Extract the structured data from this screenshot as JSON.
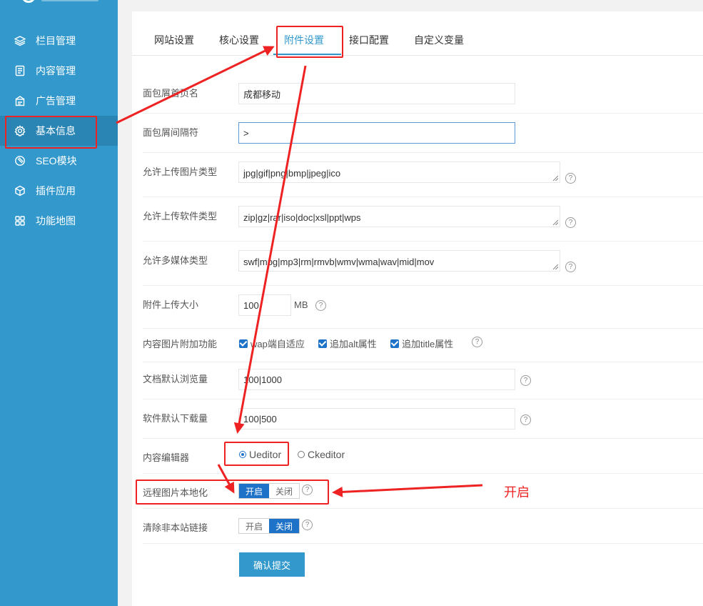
{
  "sidebar": {
    "items": [
      {
        "label": "栏目管理",
        "icon": "layers-icon"
      },
      {
        "label": "内容管理",
        "icon": "document-icon"
      },
      {
        "label": "广告管理",
        "icon": "ad-icon"
      },
      {
        "label": "基本信息",
        "icon": "gear-icon"
      },
      {
        "label": "SEO模块",
        "icon": "seo-icon"
      },
      {
        "label": "插件应用",
        "icon": "cube-icon"
      },
      {
        "label": "功能地图",
        "icon": "grid-icon"
      }
    ],
    "active_index": 3
  },
  "tabs": [
    "网站设置",
    "核心设置",
    "附件设置",
    "接口配置",
    "自定义变量"
  ],
  "active_tab": 2,
  "form": {
    "breadcrumb_home": {
      "label": "面包屑首页名",
      "value": "成都移动"
    },
    "breadcrumb_sep": {
      "label": "面包屑间隔符",
      "value": ">"
    },
    "img_types": {
      "label": "允许上传图片类型",
      "value": "jpg|gif|png|bmp|jpeg|ico"
    },
    "soft_types": {
      "label": "允许上传软件类型",
      "value": "zip|gz|rar|iso|doc|xsl|ppt|wps"
    },
    "media_types": {
      "label": "允许多媒体类型",
      "value": "swf|mpg|mp3|rm|rmvb|wmv|wma|wav|mid|mov"
    },
    "upload_size": {
      "label": "附件上传大小",
      "value": "100",
      "unit": "MB"
    },
    "img_extra": {
      "label": "内容图片附加功能",
      "options": [
        "wap端自适应",
        "追加alt属性",
        "追加title属性"
      ]
    },
    "default_views": {
      "label": "文档默认浏览量",
      "value": "100|1000"
    },
    "default_downloads": {
      "label": "软件默认下载量",
      "value": "100|500"
    },
    "editor": {
      "label": "内容编辑器",
      "options": [
        "Ueditor",
        "Ckeditor"
      ],
      "selected": "Ueditor"
    },
    "remote_img": {
      "label": "远程图片本地化",
      "on_label": "开启",
      "off_label": "关闭",
      "state": "on"
    },
    "clear_links": {
      "label": "清除非本站链接",
      "on_label": "开启",
      "off_label": "关闭",
      "state": "off"
    },
    "help_icon": "?",
    "submit_label": "确认提交"
  },
  "annotation": {
    "text": "开启",
    "color": "#ee2222"
  },
  "colors": {
    "sidebar": "#3399cc",
    "accent": "#1e73c9",
    "annotation": "#ee2222"
  }
}
